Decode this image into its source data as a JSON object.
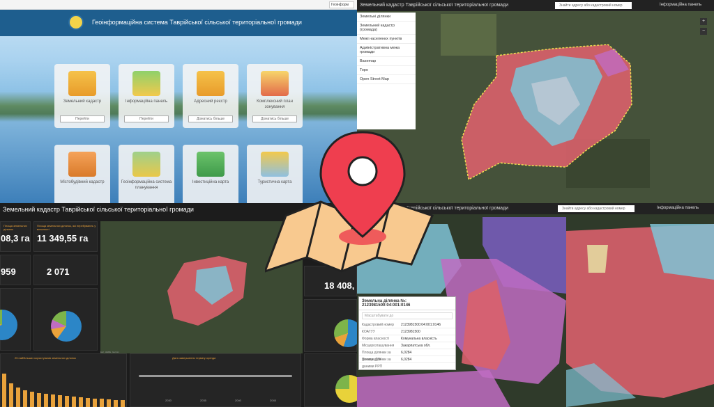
{
  "portal": {
    "browser_address": "Геоінформ",
    "title": "Геоінформаційна система Таврійської сільської територіальної громади",
    "cards": [
      {
        "label": "Земельний кадастр",
        "button": "Перейти"
      },
      {
        "label": "Інформаційна панель",
        "button": "Перейти"
      },
      {
        "label": "Адресний реєстр",
        "button": "Дізнатись більше"
      },
      {
        "label": "Комплексний план зонування",
        "button": "Дізнатись більше"
      },
      {
        "label": "Містобудівний кадастр",
        "button": ""
      },
      {
        "label": "Геоінформаційна система планування",
        "button": ""
      },
      {
        "label": "Інвестиційна карта",
        "button": ""
      },
      {
        "label": "Туристична карта",
        "button": ""
      }
    ]
  },
  "map": {
    "title": "Земельний кадастр Таврійської сільської територіальної громади",
    "search_placeholder": "Знайти адресу або кадастровий номер",
    "info_button": "Інформаційна панель",
    "layers": [
      "Земельні ділянки",
      "Земельний кадастр (громада)",
      "Межі населених пунктів",
      "Адміністративна межа громади",
      "Basemap",
      "Topo",
      "Open Street Map"
    ]
  },
  "dashboard": {
    "title": "Земельний кадастр Таврійської сільської територіальної громади",
    "kpis": [
      {
        "label": "Площа земельних ділянок",
        "value": "08,3 га"
      },
      {
        "label": "Площа земельних ділянок, які перебувають у власності",
        "value": "11 349,55 га"
      },
      {
        "label": "",
        "value": "959"
      },
      {
        "label": "",
        "value": "2 071"
      },
      {
        "label": "",
        "value": "18 408,"
      }
    ],
    "bottom_left": "25 найбільших користувачів земельних ділянок",
    "bottom_mid": "Дата завершення терміну оренди",
    "axis_years": [
      "2030",
      "2035",
      "2040",
      "2045"
    ],
    "map_credit": "Esri, HERE, Garmin",
    "colors": {
      "accent": "#e9a23b"
    }
  },
  "parcels": {
    "title": "Земельний кадастр Таврійської сільської територіальної громади",
    "search_placeholder": "Знайти адресу або кадастровий номер",
    "info_button": "Інформаційна панель",
    "popup_title": "Земельна ділянка №: 2123981500:04:001:0146",
    "popup_search": "Масштабувати до",
    "popup_rows": [
      {
        "k": "Кадастровий номер",
        "v": "2123981500:04:001:0146"
      },
      {
        "k": "КОАТУУ",
        "v": "2123981500"
      },
      {
        "k": "Форма власності",
        "v": "Комунальна власність"
      },
      {
        "k": "Місцерозташування",
        "v": "Закарпатська обл."
      },
      {
        "k": "Площа ділянки за даними ДЗК",
        "v": "6,0284"
      },
      {
        "k": "Площа ділянки за даними РРП",
        "v": "6,0284"
      }
    ]
  }
}
